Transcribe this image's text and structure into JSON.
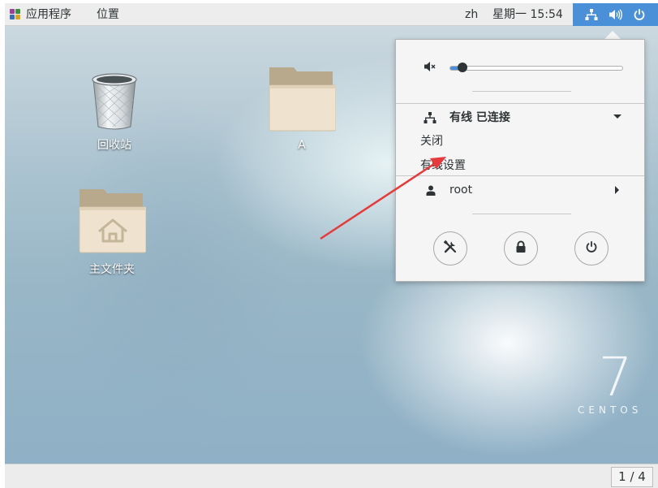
{
  "topbar": {
    "apps_label": "应用程序",
    "places_label": "位置",
    "input_method": "zh",
    "clock": "星期一 15:54",
    "status_icons": [
      "network-wired-icon",
      "volume-icon",
      "power-icon"
    ],
    "accent_color": "#4a90d9"
  },
  "desktop": {
    "icons": [
      {
        "label": "回收站",
        "icon": "trash-icon"
      },
      {
        "label": "A",
        "icon": "folder-icon"
      },
      {
        "label": "主文件夹",
        "icon": "home-folder-icon"
      }
    ],
    "brand": {
      "number": "7",
      "word": "CENTOS"
    }
  },
  "system_menu": {
    "volume_level": 0.07,
    "wired_title": "有线 已连接",
    "wired_items": [
      "关闭",
      "有线设置"
    ],
    "user_name": "root",
    "actions": [
      "settings-icon",
      "lock-icon",
      "power-icon"
    ]
  },
  "bottombar": {
    "workspace": "1 / 4"
  },
  "annotation": {
    "arrow_color": "#e8393a"
  }
}
